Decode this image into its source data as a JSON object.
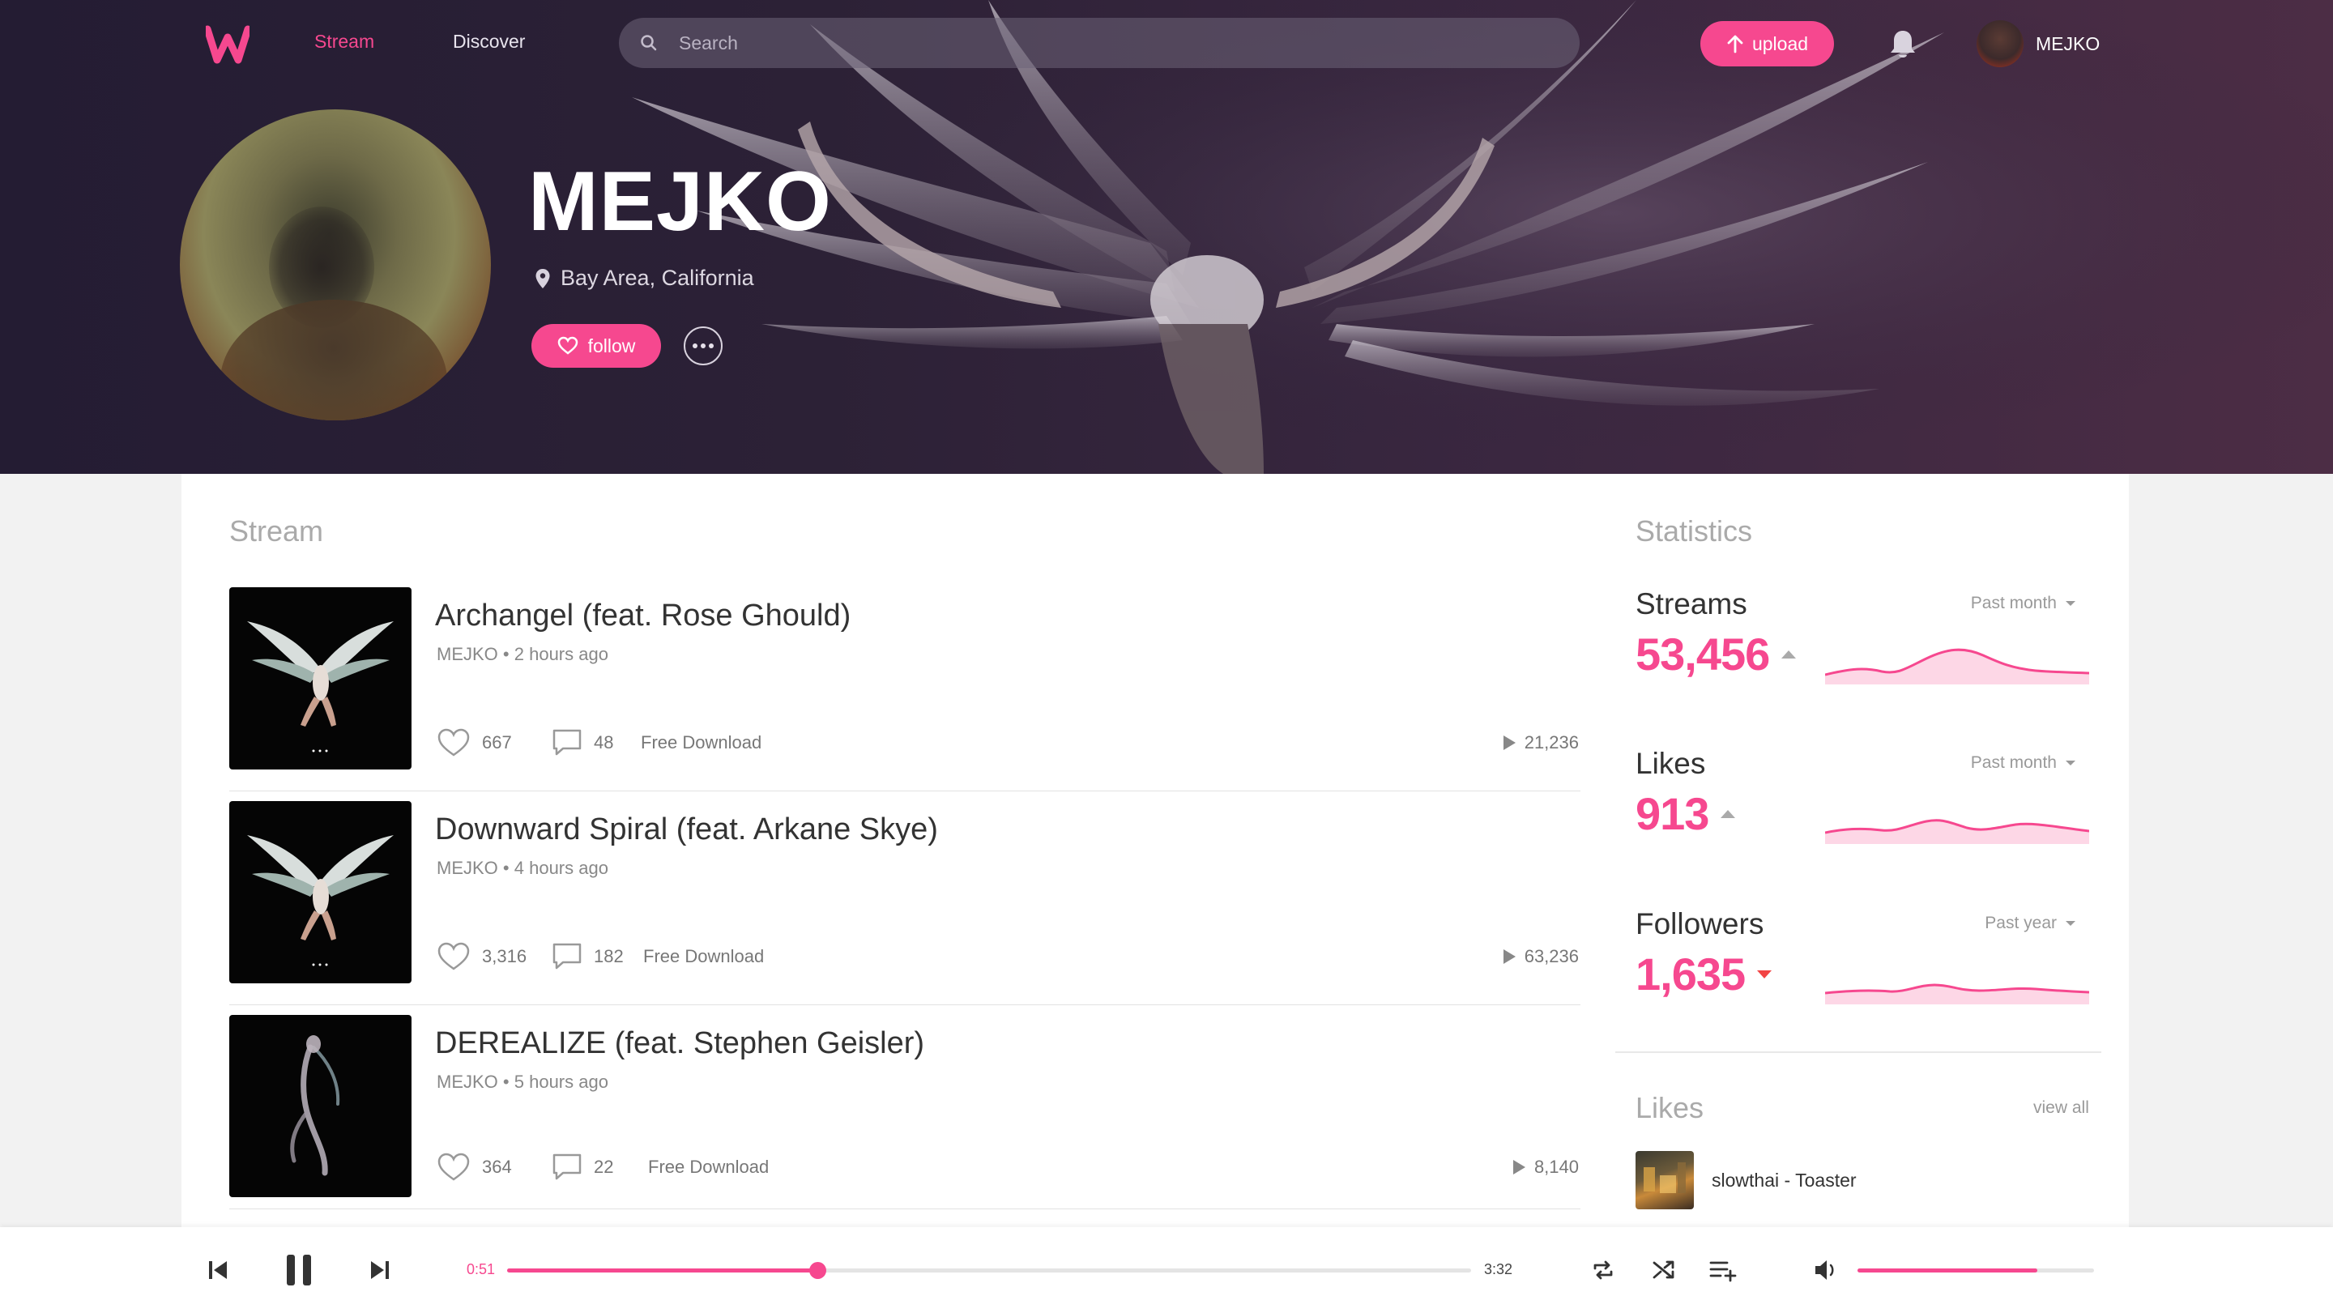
{
  "colors": {
    "accent": "#f6488f",
    "hero_dark": "#241c33"
  },
  "nav": {
    "logo_icon": "w-logo-icon",
    "stream_label": "Stream",
    "discover_label": "Discover",
    "search_placeholder": "Search",
    "upload_label": "upload",
    "user_name": "MEJKO"
  },
  "profile": {
    "name": "MEJKO",
    "location": "Bay Area, California",
    "follow_label": "follow"
  },
  "stream": {
    "title": "Stream",
    "tracks": [
      {
        "title": "Archangel (feat. Rose Ghould)",
        "artist": "MEJKO",
        "time": "2 hours ago",
        "likes": "667",
        "comments": "48",
        "download": "Free Download",
        "plays": "21,236"
      },
      {
        "title": "Downward Spiral (feat. Arkane Skye)",
        "artist": "MEJKO",
        "time": "4 hours ago",
        "likes": "3,316",
        "comments": "182",
        "download": "Free Download",
        "plays": "63,236"
      },
      {
        "title": "DEREALIZE (feat. Stephen Geisler)",
        "artist": "MEJKO",
        "time": "5 hours ago",
        "likes": "364",
        "comments": "22",
        "download": "Free Download",
        "plays": "8,140"
      }
    ]
  },
  "statistics": {
    "title": "Statistics",
    "items": [
      {
        "label": "Streams",
        "range": "Past month",
        "value": "53,456",
        "trend": "up"
      },
      {
        "label": "Likes",
        "range": "Past month",
        "value": "913",
        "trend": "up"
      },
      {
        "label": "Followers",
        "range": "Past year",
        "value": "1,635",
        "trend": "down"
      }
    ]
  },
  "likes": {
    "title": "Likes",
    "view_all": "view all",
    "items": [
      {
        "label": "slowthai - Toaster"
      }
    ]
  },
  "player": {
    "current_time": "0:51",
    "total_time": "3:32",
    "progress": 0.322,
    "volume": 0.76
  }
}
